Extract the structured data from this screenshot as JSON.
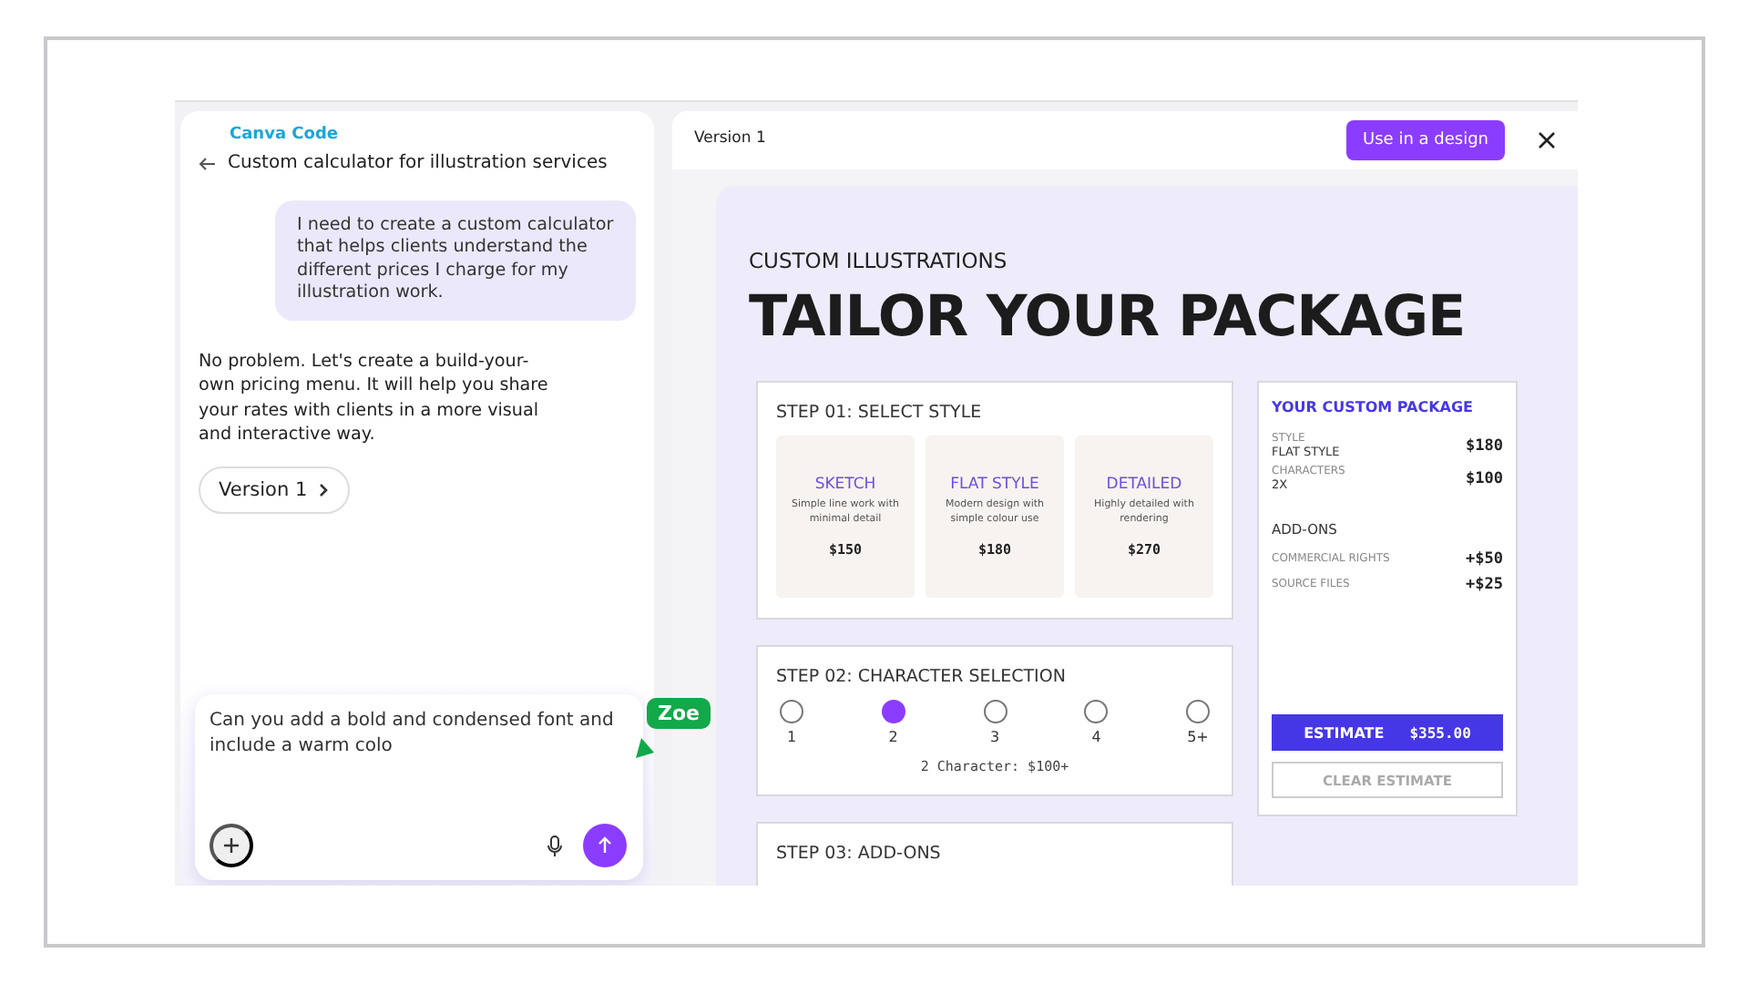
{
  "chat": {
    "brand": "Canva Code",
    "title": "Custom calculator for illustration services",
    "messages": [
      {
        "kind": "user",
        "text": "I need to create a custom calculator that helps clients understand the different prices I charge for my illustration work."
      },
      {
        "kind": "assistant",
        "text": "No problem. Let's create a build-your-own pricing menu. It will help you share your rates with clients in a more visual and interactive way."
      }
    ],
    "version_chip": "Version 1",
    "input_value": "Can you add a bold and condensed font and include a warm colo",
    "cursor_label": "Zoe"
  },
  "preview": {
    "title": "Version 1",
    "use_button": "Use in a design",
    "eyebrow": "CUSTOM ILLUSTRATIONS",
    "headline": "TAILOR YOUR PACKAGE",
    "step1": {
      "title": "STEP 01: SELECT STYLE",
      "styles": [
        {
          "name": "SKETCH",
          "desc": "Simple line work with minimal detail",
          "price": "$150"
        },
        {
          "name": "FLAT STYLE",
          "desc": "Modern design with simple colour use",
          "price": "$180"
        },
        {
          "name": "DETAILED",
          "desc": "Highly detailed with rendering",
          "price": "$270"
        }
      ]
    },
    "step2": {
      "title": "STEP 02: CHARACTER SELECTION",
      "options": [
        {
          "label": "1",
          "selected": false
        },
        {
          "label": "2",
          "selected": true
        },
        {
          "label": "3",
          "selected": false
        },
        {
          "label": "4",
          "selected": false
        },
        {
          "label": "5+",
          "selected": false
        }
      ],
      "summary": "2 Character: $100+"
    },
    "step3": {
      "title": "STEP 03: ADD-ONS"
    },
    "package": {
      "title": "YOUR CUSTOM PACKAGE",
      "lines": [
        {
          "label": "STYLE",
          "value": "FLAT STYLE",
          "price": "$180"
        },
        {
          "label": "CHARACTERS",
          "value": "2X",
          "price": "$100"
        }
      ],
      "addons_title": "ADD-ONS",
      "addons": [
        {
          "label": "COMMERCIAL RIGHTS",
          "price": "+$50"
        },
        {
          "label": "SOURCE FILES",
          "price": "+$25"
        }
      ],
      "estimate_label": "ESTIMATE",
      "estimate_value": "$355.00",
      "clear": "CLEAR ESTIMATE"
    }
  }
}
